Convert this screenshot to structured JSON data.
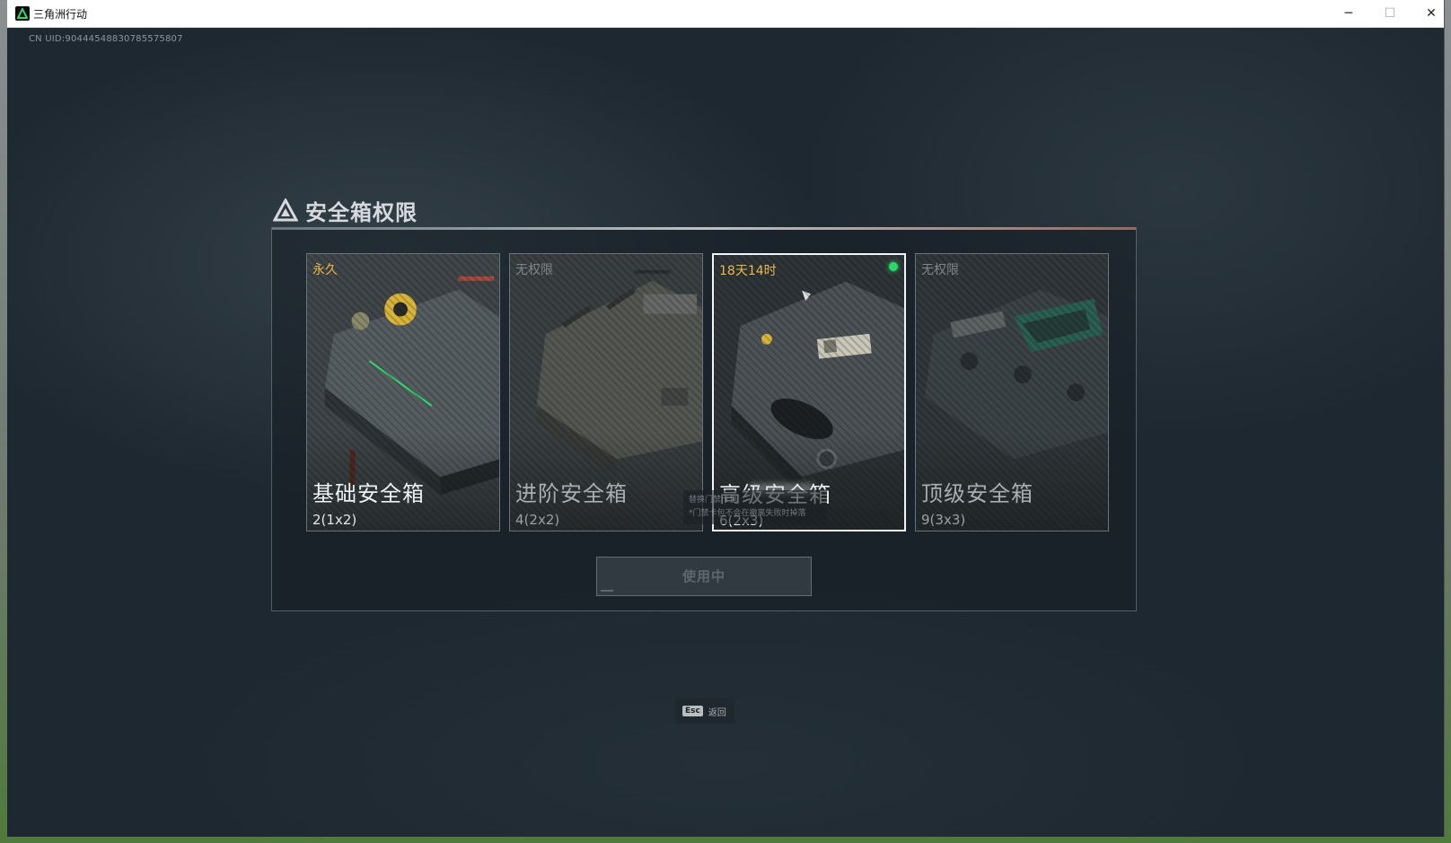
{
  "window": {
    "title": "三角洲行动",
    "controls": [
      "minimize",
      "maximize",
      "close"
    ]
  },
  "uid": "CN UID:9044454883078557​5807",
  "panel": {
    "title": "安全箱权限",
    "icon": "delta-logo-icon"
  },
  "cards": [
    {
      "status": "永久",
      "name": "基础安全箱",
      "size": "2(1x2)",
      "locked": false
    },
    {
      "status": "无权限",
      "name": "进阶安全箱",
      "size": "4(2x2)",
      "locked": true
    },
    {
      "status": "18天14时",
      "name": "高级安全箱",
      "size": "6(2x3)",
      "locked": false,
      "active": true
    },
    {
      "status": "无权限",
      "name": "顶级安全箱",
      "size": "9(3x3)",
      "locked": true
    }
  ],
  "tooltip": {
    "line1": "替换门禁卡包",
    "line2": "*门禁卡包不会在撤离失败时掉落"
  },
  "use_button": "使用中",
  "esc_hint": {
    "key": "Esc",
    "label": "返回"
  },
  "colors": {
    "active_dot": "#2bd96a",
    "status_gold": "#e8b94a",
    "selected_border": "#f2f4f5"
  }
}
